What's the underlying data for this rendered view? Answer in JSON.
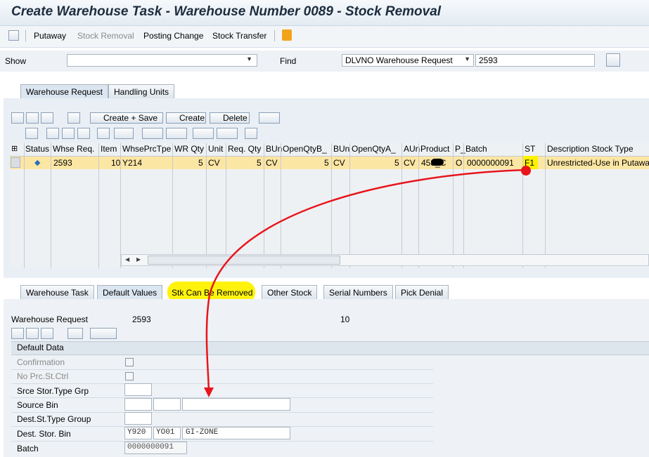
{
  "window": {
    "title": "Create Warehouse Task - Warehouse Number 0089 - Stock Removal"
  },
  "toolbar": {
    "items": [
      {
        "label": "Putaway",
        "enabled": true
      },
      {
        "label": "Stock Removal",
        "enabled": false
      },
      {
        "label": "Posting Change",
        "enabled": true
      },
      {
        "label": "Stock Transfer",
        "enabled": true
      }
    ]
  },
  "show": {
    "label": "Show",
    "value": ""
  },
  "find": {
    "label": "Find",
    "type_value": "DLVNO Warehouse Request",
    "value": "2593"
  },
  "top_tabs": [
    {
      "label": "Warehouse Request",
      "active": true
    },
    {
      "label": "Handling Units",
      "active": false
    }
  ],
  "grid_toolbar": {
    "create_save": "Create + Save",
    "create": "Create",
    "delete": "Delete"
  },
  "grid": {
    "columns": [
      "Status",
      "Whse Req.",
      "Item",
      "WhsePrcTpe",
      "WR Qty",
      "Unit",
      "Req. Qty",
      "BUn",
      "OpenQtyB_",
      "BUn",
      "OpenQtyA_",
      "AUn",
      "Product",
      "P_",
      "Batch",
      "ST",
      "Description Stock Type"
    ],
    "rows": [
      {
        "whse_req": "2593",
        "item": "10",
        "prc_type": "Y214",
        "wr_qty": "5",
        "unit": "CV",
        "req_qty": "5",
        "bun": "CV",
        "open_b": "5",
        "bun2": "CV",
        "open_a": "5",
        "aun": "CV",
        "product": "458_C",
        "p": "O",
        "batch": "0000000091",
        "st": "F1",
        "desc": "Unrestricted-Use in Putaway"
      }
    ]
  },
  "bottom_tabs": [
    {
      "label": "Warehouse Task",
      "active": false
    },
    {
      "label": "Default Values",
      "active": true
    },
    {
      "label": "Stk Can Be Removed",
      "active": false,
      "highlighted": true
    },
    {
      "label": "Other Stock",
      "active": false
    },
    {
      "label": "Serial Numbers",
      "active": false
    },
    {
      "label": "Pick Denial",
      "active": false
    }
  ],
  "detail": {
    "whse_req_label": "Warehouse Request",
    "whse_req_value": "2593",
    "item_value": "10",
    "section_title": "Default Data",
    "fields": {
      "confirmation": "Confirmation",
      "no_prc": "No Prc.St.Ctrl",
      "srce_grp": "Srce Stor.Type Grp",
      "source_bin": "Source Bin",
      "dest_grp": "Dest.St.Type Group",
      "dest_bin": "Dest. Stor. Bin",
      "batch": "Batch"
    },
    "dest_bin_values": [
      "Y920",
      "YO01",
      "GI-ZONE"
    ],
    "batch_value": "0000000091"
  },
  "colors": {
    "highlight": "#fff200",
    "arrow": "#e8151b",
    "selected_row": "#fce6a4"
  }
}
